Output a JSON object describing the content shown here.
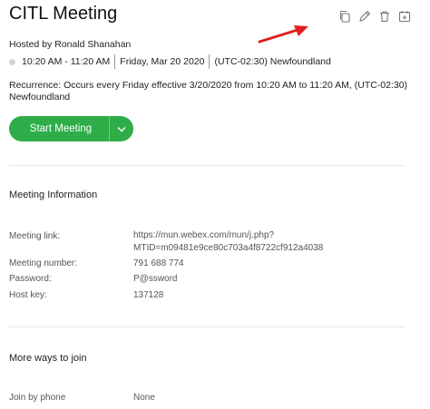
{
  "title": "CITL Meeting",
  "toolbar": {
    "icons": [
      "copy-icon",
      "edit-icon",
      "delete-icon",
      "add-to-calendar-icon"
    ]
  },
  "host": "Hosted by Ronald Shanahan",
  "schedule": {
    "time": "10:20 AM - 11:20 AM",
    "date": "Friday, Mar 20 2020",
    "timezone": "(UTC-02:30) Newfoundland"
  },
  "recurrence": "Recurrence: Occurs every Friday effective 3/20/2020 from 10:20 AM to 11:20 AM, (UTC-02:30) Newfoundland",
  "start_button": {
    "label": "Start Meeting",
    "color": "#2ead49"
  },
  "meeting_info": {
    "heading": "Meeting Information",
    "link_label": "Meeting link:",
    "link_line1": "https://mun.webex.com/mun/j.php?",
    "link_line2": "MTID=m09481e9ce80c703a4f8722cf912a4038",
    "number_label": "Meeting number:",
    "number_value": "791 688 774",
    "password_label": "Password:",
    "password_value": "P@ssword",
    "hostkey_label": "Host key:",
    "hostkey_value": "137128"
  },
  "more_ways": {
    "heading": "More ways to join",
    "phone_label": "Join by phone",
    "phone_value": "None"
  },
  "annotation_arrow_color": "#e02020"
}
